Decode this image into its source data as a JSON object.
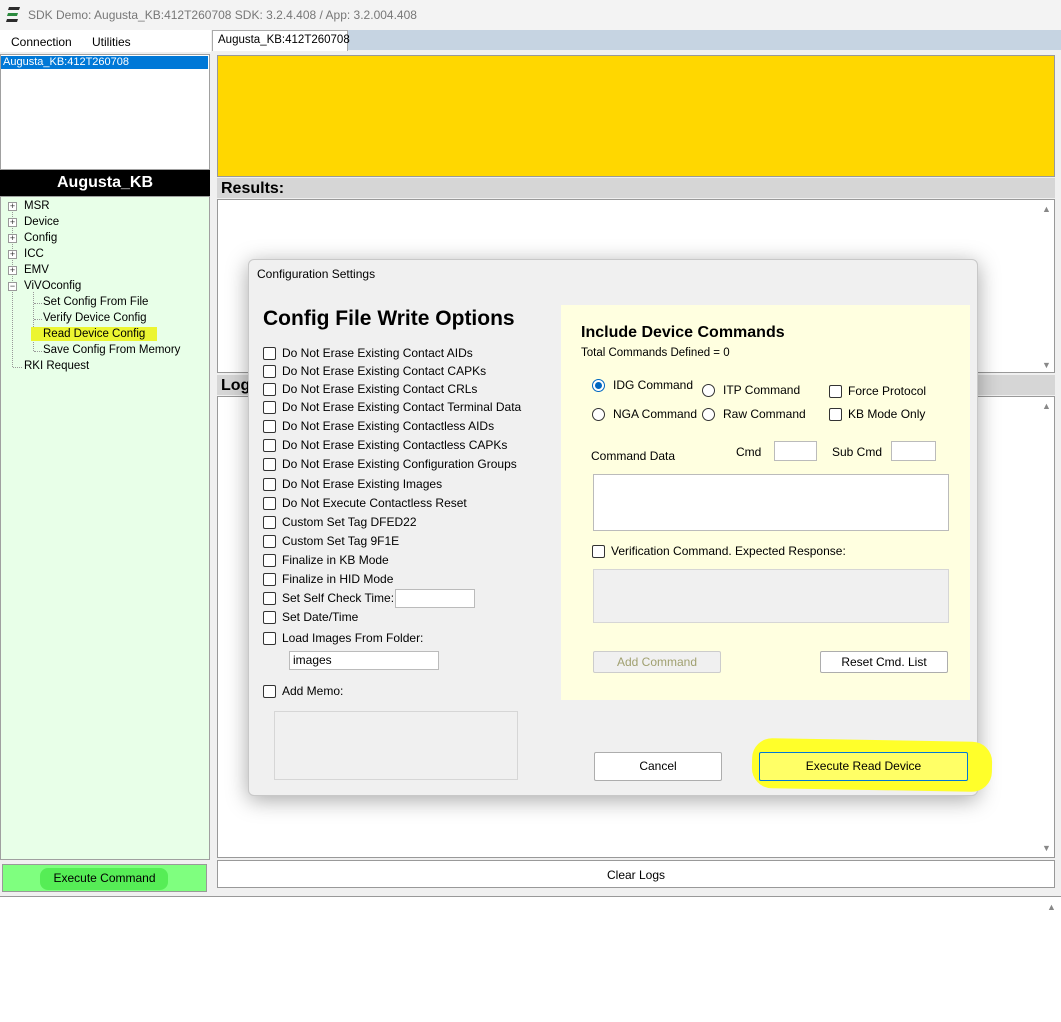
{
  "window": {
    "title": "SDK Demo: Augusta_KB:412T260708   SDK: 3.2.4.408  /  App: 3.2.004.408"
  },
  "menu": {
    "connection": "Connection",
    "utilities": "Utilities"
  },
  "device_list": {
    "selected": "Augusta_KB:412T260708"
  },
  "device_header": "Augusta_KB",
  "tree": {
    "msr": "MSR",
    "device": "Device",
    "config": "Config",
    "icc": "ICC",
    "emv": "EMV",
    "vivoconfig": "ViVOconfig",
    "set_config_from_file": "Set Config From File",
    "verify_device_config": "Verify Device Config",
    "read_device_config": "Read Device Config",
    "save_config_from_memory": "Save Config From Memory",
    "rki_request": "RKI Request",
    "expand_symbol": "+",
    "collapse_symbol": "−"
  },
  "execute_command_label": "Execute Command",
  "tab": {
    "label": "Augusta_KB:412T260708"
  },
  "results_header": "Results:",
  "logs_header": "Log",
  "clear_logs_label": "Clear Logs",
  "dialog": {
    "title": "Configuration Settings",
    "options_title": "Config File Write Options",
    "options": [
      "Do Not Erase Existing Contact AIDs",
      "Do Not Erase Existing Contact CAPKs",
      "Do Not Erase Existing Contact CRLs",
      "Do Not Erase Existing Contact Terminal Data",
      "Do Not Erase Existing Contactless AIDs",
      "Do Not Erase Existing Contactless CAPKs",
      "Do Not Erase Existing Configuration Groups",
      "Do Not Erase Existing Images",
      "Do Not Execute Contactless Reset",
      "Custom Set Tag DFED22",
      "Custom Set Tag 9F1E",
      "Finalize in KB Mode",
      "Finalize in HID Mode",
      "Set Self Check Time:",
      "Set Date/Time",
      "Load Images From Folder:",
      "Add Memo:"
    ],
    "images_folder_value": "images",
    "self_check_time_value": "",
    "include": {
      "title": "Include Device Commands",
      "total": "Total Commands Defined = 0",
      "radio_idg": "IDG Command",
      "radio_itp": "ITP Command",
      "radio_nga": "NGA Command",
      "radio_raw": "Raw Command",
      "force_protocol": "Force Protocol",
      "kb_mode_only": "KB Mode Only",
      "command_data": "Command Data",
      "cmd": "Cmd",
      "sub_cmd": "Sub Cmd",
      "verification": "Verification Command. Expected Response:",
      "add_command": "Add Command",
      "reset_cmd_list": "Reset Cmd. List"
    },
    "cancel": "Cancel",
    "execute_read_device": "Execute Read Device"
  },
  "colors": {
    "yellow_panel": "#ffd700",
    "tree_background": "#e8ffe8",
    "execute_button": "#7fff7f",
    "selection_blue": "#0078d7",
    "include_panel": "#ffffe0"
  }
}
